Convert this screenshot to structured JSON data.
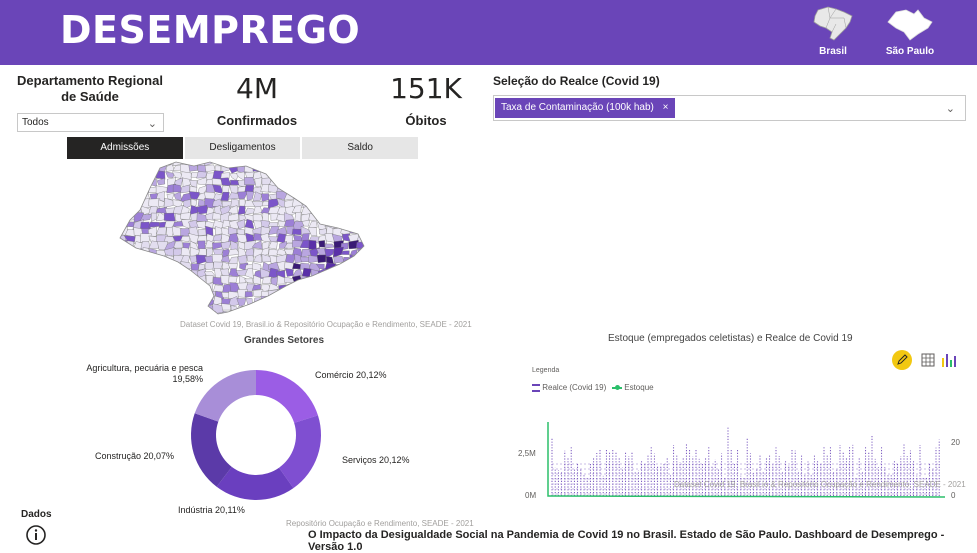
{
  "header": {
    "title": "DESEMPREGO",
    "nav": [
      {
        "label": "Brasil",
        "icon": "brazil-map-icon"
      },
      {
        "label": "São Paulo",
        "icon": "sao-paulo-map-icon"
      }
    ],
    "bg_color": "#6a45b8"
  },
  "filters": {
    "department_label": "Departamento Regional de Saúde",
    "department_value": "Todos",
    "highlight_label": "Seleção do Realce (Covid 19)",
    "highlight_chip": "Taxa de Contaminação (100k hab)"
  },
  "kpis": [
    {
      "value": "4M",
      "label": "Confirmados"
    },
    {
      "value": "151K",
      "label": "Óbitos"
    }
  ],
  "tabs": [
    "Admissões",
    "Desligamentos",
    "Saldo"
  ],
  "map": {
    "source": "Dataset Covid 19, Brasil.io & Repositório Ocupação e Rendimento, SEADE - 2021"
  },
  "donut": {
    "title": "Grandes Setores",
    "source": "Repositório Ocupação e Rendimento, SEADE - 2021"
  },
  "combo": {
    "title": "Estoque (empregados celetistas) e Realce de Covid 19",
    "legend_title": "Legenda",
    "source": "Dataset Covid 19. Brasil.io & Repositório Ocupação e Rendimento, SEADE - 2021"
  },
  "chart_data": [
    {
      "type": "pie",
      "title": "Grandes Setores",
      "categories": [
        "Comércio",
        "Serviços",
        "Indústria",
        "Construção",
        "Agricultura, pecuária e pesca"
      ],
      "values": [
        20.12,
        20.12,
        20.11,
        20.07,
        19.58
      ],
      "labels": [
        "Comércio 20,12%",
        "Serviços 20,12%",
        "Indústria 20,11%",
        "Construção 20,07%",
        "Agricultura, pecuária e pesca 19,58%"
      ],
      "colors": [
        "#9b5de5",
        "#7f4fd1",
        "#6a3fbf",
        "#5b3aa8",
        "#a88ed8"
      ]
    },
    {
      "type": "bar",
      "title": "Estoque (empregados celetistas) e Realce de Covid 19",
      "series": [
        {
          "name": "Realce (Covid 19)",
          "color": "#6a45b8"
        },
        {
          "name": "Estoque",
          "color": "#2bbf6a"
        }
      ],
      "y_left_ticks": [
        "0M",
        "2,5M"
      ],
      "y_right_ticks": [
        "0",
        "20"
      ]
    }
  ],
  "footer": {
    "dados_label": "Dados",
    "text": "O Impacto da Desigualdade Social na Pandemia de Covid 19 no Brasil. Estado de São Paulo. Dashboard de Desemprego - Versão 1.0"
  }
}
